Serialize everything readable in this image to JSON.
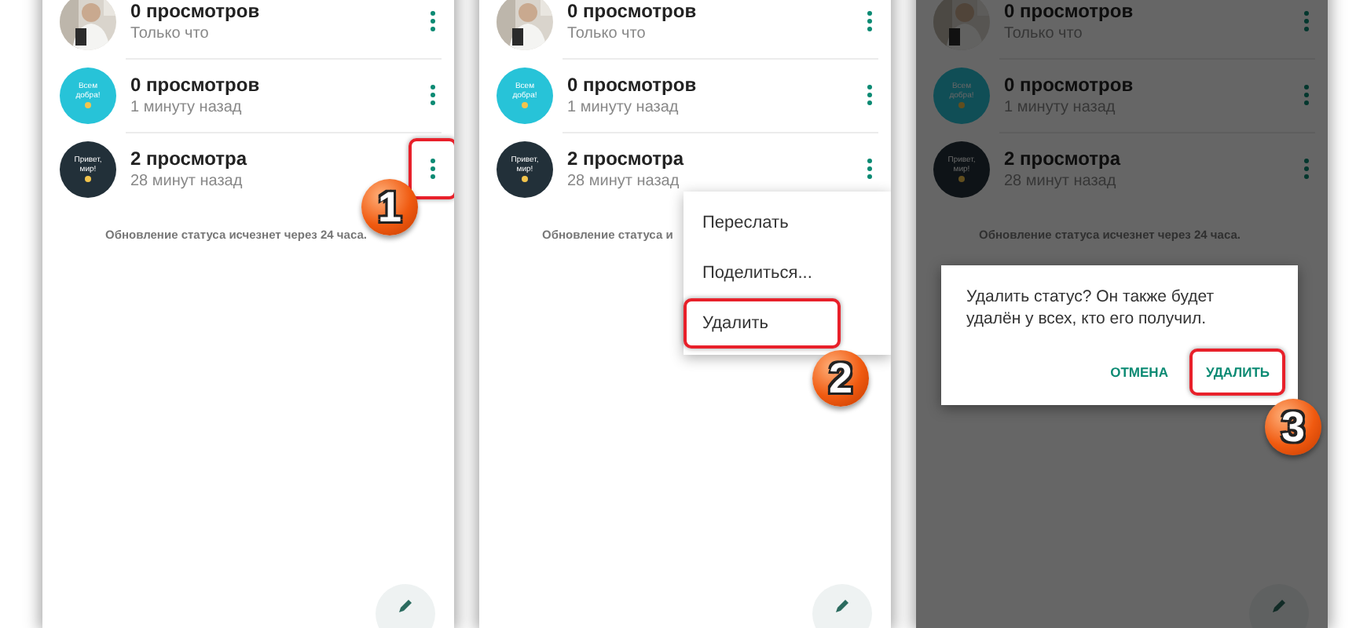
{
  "panels": [
    {
      "kind": "list",
      "dimmed": false,
      "step": "1",
      "statuses": [
        {
          "title": "0 просмотров",
          "time": "Только что",
          "highlighted": false
        },
        {
          "avatar": {
            "kind": "teal",
            "text": "Всем добра!"
          },
          "title": "0 просмотров",
          "time": "1 минуту назад",
          "highlighted": false
        },
        {
          "avatar": {
            "kind": "dark",
            "text": "Привет, мир!"
          },
          "title": "2 просмотра",
          "time": "28 минут назад",
          "highlighted": true
        }
      ],
      "note": "Обновление статуса исчезнет через 24 часа."
    },
    {
      "kind": "menu",
      "dimmed": false,
      "step": "2",
      "statuses": [
        {
          "title": "0 просмотров",
          "time": "Только что",
          "highlighted": false
        },
        {
          "avatar": {
            "kind": "teal",
            "text": "Всем добра!"
          },
          "title": "0 просмотров",
          "time": "1 минуту назад",
          "highlighted": false
        },
        {
          "avatar": {
            "kind": "dark",
            "text": "Привет, мир!"
          },
          "title": "2 просмотра",
          "time": "28 минут назад",
          "highlighted": false
        }
      ],
      "note": "Обновление статуса и",
      "menu": [
        {
          "label": "Переслать",
          "highlighted": false
        },
        {
          "label": "Поделиться...",
          "highlighted": false
        },
        {
          "label": "Удалить",
          "highlighted": true
        }
      ]
    },
    {
      "kind": "dialog",
      "dimmed": true,
      "step": "3",
      "statuses": [
        {
          "title": "0 просмотров",
          "time": "Только что",
          "highlighted": false
        },
        {
          "avatar": {
            "kind": "teal",
            "text": "Всем добра!"
          },
          "title": "0 просмотров",
          "time": "1 минуту назад",
          "highlighted": false
        },
        {
          "avatar": {
            "kind": "dark",
            "text": "Привет, мир!"
          },
          "title": "2 просмотра",
          "time": "28 минут назад",
          "highlighted": false
        }
      ],
      "note": "Обновление статуса исчезнет через 24 часа.",
      "dialog": {
        "message": "Удалить статус? Он также будет удалён у всех, кто его получил.",
        "buttons": [
          {
            "label": "ОТМЕНА",
            "highlighted": false
          },
          {
            "label": "УДАЛИТЬ",
            "highlighted": true
          }
        ]
      }
    }
  ]
}
